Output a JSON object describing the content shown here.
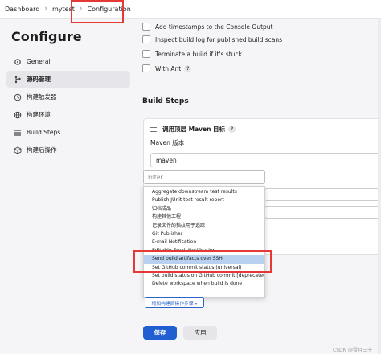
{
  "breadcrumb": {
    "items": [
      "Dashboard",
      "mytest",
      "Configuration"
    ],
    "separator": "›"
  },
  "sidebar": {
    "title": "Configure",
    "items": [
      {
        "label": "General",
        "icon": "gear-icon"
      },
      {
        "label": "源码管理",
        "icon": "branch-icon",
        "active": true
      },
      {
        "label": "构建触发器",
        "icon": "clock-icon"
      },
      {
        "label": "构建环境",
        "icon": "globe-icon"
      },
      {
        "label": "Build Steps",
        "icon": "list-icon"
      },
      {
        "label": "构建后操作",
        "icon": "cube-icon"
      }
    ]
  },
  "options": {
    "timestamps": "Add timestamps to the Console Output",
    "inspect_log": "Inspect build log for published build scans",
    "terminate": "Terminate a build if it's stuck",
    "with_ant": "With Ant",
    "help": "?"
  },
  "build_steps": {
    "title": "Build Steps",
    "step_name": "调用顶层 Maven 目标",
    "maven_version_label": "Maven 版本",
    "maven_version_value": "maven"
  },
  "filter": {
    "placeholder": "Filter"
  },
  "dropdown": {
    "items": [
      "Aggregate downstream test results",
      "Publish JUnit test result report",
      "归档成品",
      "构建其他工程",
      "记录文件的指纹用于追踪",
      "Git Publisher",
      "E-mail Notification",
      "Editable Email Notification",
      "Send build artifacts over SSH",
      "Set GitHub commit status (universal)",
      "Set build status on GitHub commit [deprecated]",
      "Delete workspace when build is done"
    ],
    "selected_index": 8
  },
  "actions": {
    "add_post_build": "增加构建后操作步骤 ▾",
    "save": "保存",
    "apply": "应用"
  },
  "watermark": "CSDN @雪月三十",
  "colors": {
    "highlight": "#e53935",
    "primary": "#1f5fd1",
    "selected_row": "#b9d1f0"
  }
}
